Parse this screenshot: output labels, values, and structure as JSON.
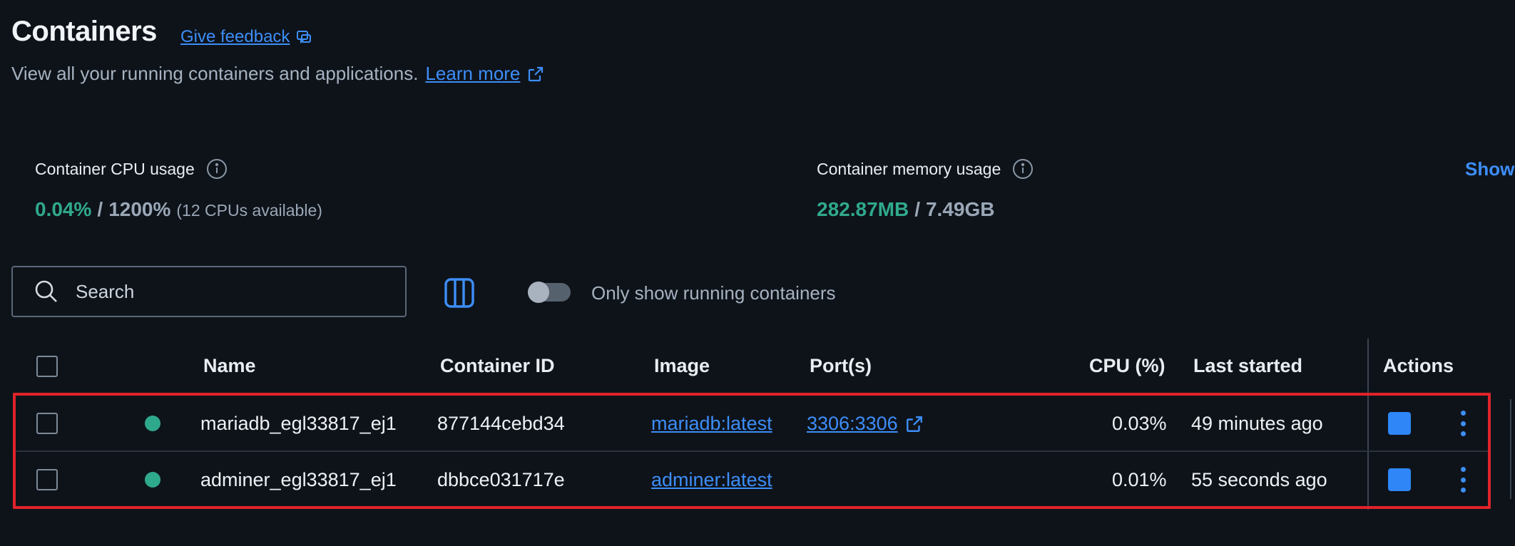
{
  "header": {
    "title": "Containers",
    "feedback_label": "Give feedback",
    "subtitle": "View all your running containers and applications.",
    "learn_more_label": "Learn more"
  },
  "stats": {
    "cpu": {
      "label": "Container CPU usage",
      "used": "0.04%",
      "separator": "/",
      "total": "1200%",
      "note": "(12 CPUs available)"
    },
    "memory": {
      "label": "Container memory usage",
      "used": "282.87MB",
      "separator": "/",
      "total": "7.49GB"
    },
    "show_label": "Show"
  },
  "toolbar": {
    "search_placeholder": "Search",
    "running_toggle_label": "Only show running containers",
    "running_toggle_on": false
  },
  "table": {
    "columns": [
      "Name",
      "Container ID",
      "Image",
      "Port(s)",
      "CPU (%)",
      "Last started",
      "Actions"
    ],
    "rows": [
      {
        "name": "mariadb_egl33817_ej1",
        "container_id": "877144cebd34",
        "image": "mariadb:latest",
        "ports": "3306:3306",
        "cpu": "0.03%",
        "last_started": "49 minutes ago",
        "status_color": "#2fa98c"
      },
      {
        "name": "adminer_egl33817_ej1",
        "container_id": "dbbce031717e",
        "image": "adminer:latest",
        "ports": "",
        "cpu": "0.01%",
        "last_started": "55 seconds ago",
        "status_color": "#2fa98c"
      }
    ]
  },
  "colors": {
    "background": "#0e131a",
    "accent": "#3d8ef8",
    "running": "#2fa98c",
    "highlight": "#e0232a"
  }
}
